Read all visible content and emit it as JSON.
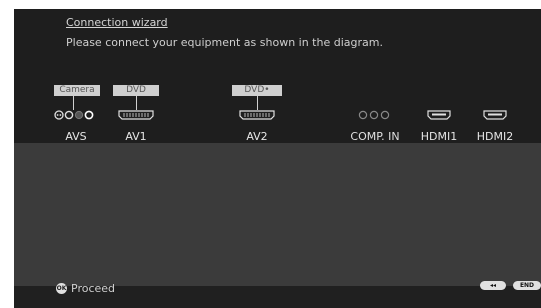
{
  "wizard": {
    "title": "Connection wizard",
    "instruction": "Please connect your equipment as shown in the diagram."
  },
  "devices": [
    {
      "label": "Camera",
      "port": "AVS"
    },
    {
      "label": "DVD",
      "port": "AV1"
    },
    {
      "label": "DVD•",
      "port": "AV2"
    }
  ],
  "ports": {
    "avs": "AVS",
    "av1": "AV1",
    "av2": "AV2",
    "comp_in": "COMP. IN",
    "hdmi1": "HDMI1",
    "hdmi2": "HDMI2"
  },
  "footer": {
    "ok_icon": "OK",
    "proceed_label": "Proceed",
    "rewind_icon": "◂◂",
    "end_label": "END"
  },
  "colors": {
    "screen_bg": "#1e1e1e",
    "diagram_area": "#3b3b3b",
    "label_bg": "#cfcfcf",
    "text": "#e6e6e6"
  }
}
